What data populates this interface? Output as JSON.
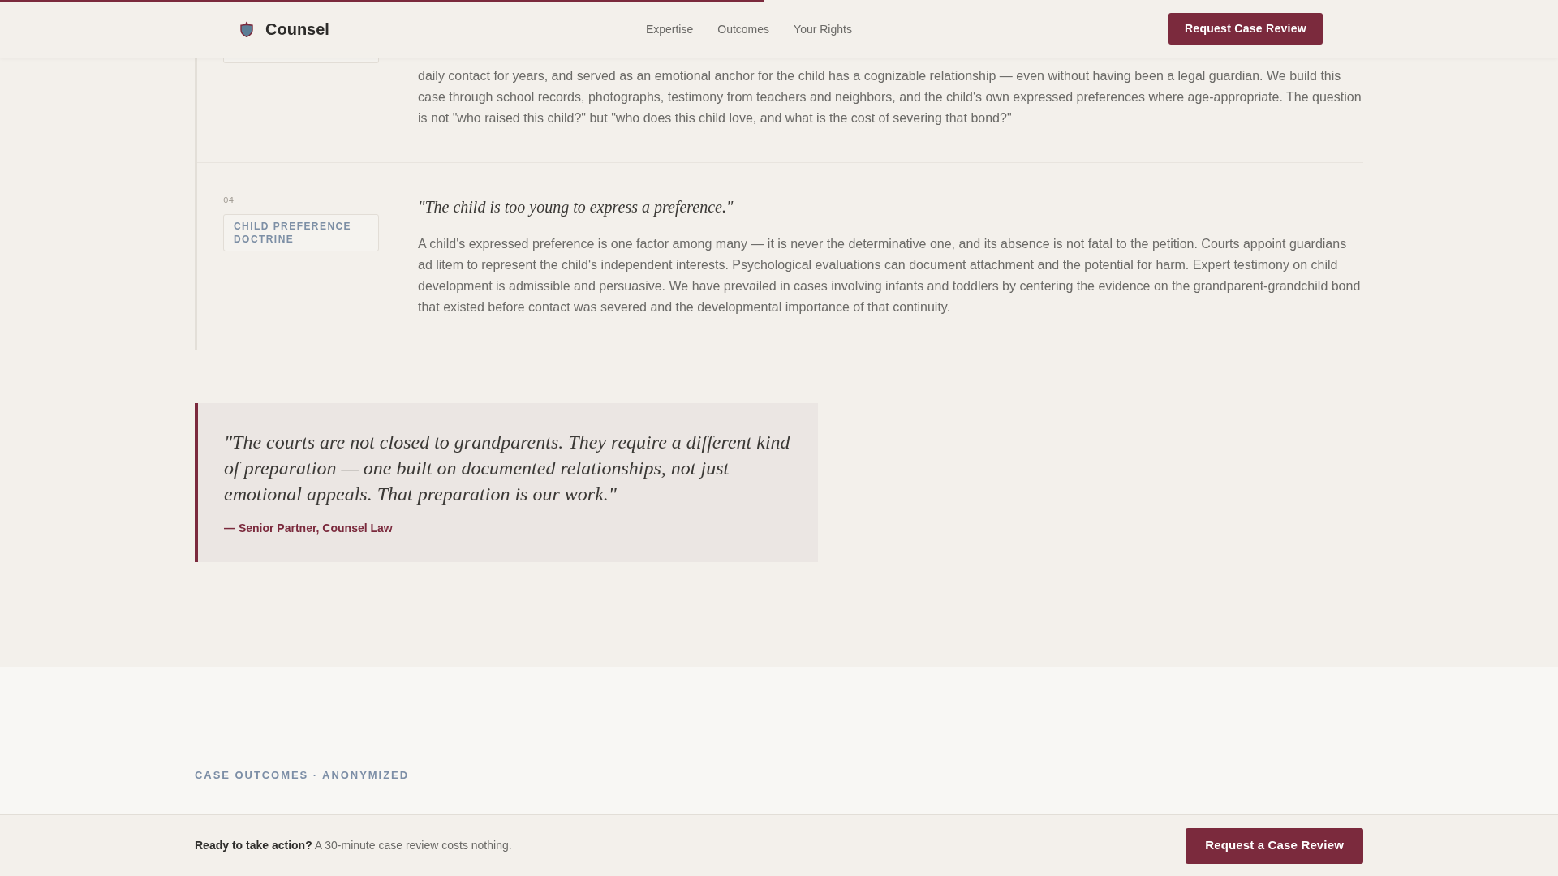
{
  "header": {
    "progress": {
      "level": 0.49
    },
    "brand": "Counsel",
    "nav": [
      {
        "label": "Expertise"
      },
      {
        "label": "Outcomes"
      },
      {
        "label": "Your Rights"
      }
    ],
    "cta": "Request Case Review"
  },
  "objections": [
    {
      "kind": "clipped",
      "response": "daily contact for years, and served as an emotional anchor for the child has a cognizable relationship — even without having been a legal guardian. We build this case through school records, photographs, testimony from teachers and neighbors, and the child's own expressed preferences where age-appropriate. The question is not \"who raised this child?\" but \"who does this child love, and what is the cost of severing that bond?\""
    },
    {
      "kind": "full",
      "number": "04",
      "tag": "CHILD PREFERENCE DOCTRINE",
      "objection": "\"The child is too young to express a preference.\"",
      "response": "A child's expressed preference is one factor among many — it is never the determinative one, and its absence is not fatal to the petition. Courts appoint guardians ad litem to represent the child's independent interests. Psychological evaluations can document attachment and the potential for harm. Expert testimony on child development is admissible and persuasive. We have prevailed in cases involving infants and toddlers by centering the evidence on the grandparent-grandchild bond that existed before contact was severed and the developmental importance of that continuity."
    }
  ],
  "pull_quote": {
    "text": "\"The courts are not closed to grandparents. They require a different kind of preparation — one built on documented relationships, not just emotional appeals. That preparation is our work.\"",
    "attribution": "— Senior Partner, Counsel Law"
  },
  "outcomes": {
    "eyebrow": "CASE OUTCOMES · ANONYMIZED"
  },
  "action_bar": {
    "text": "**Ready to take action?** A 30-minute case review costs nothing.",
    "button": "Request a Case Review"
  }
}
